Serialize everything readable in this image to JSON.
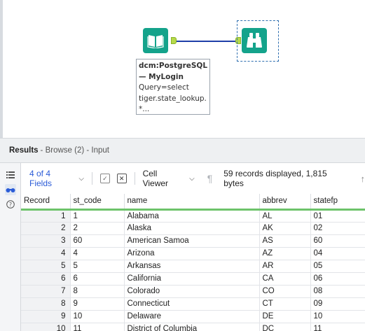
{
  "canvas": {
    "annotation": {
      "line1": "dcm:PostgreSQL",
      "line2": "— MyLogin",
      "line3": "Query=select",
      "line4": "tiger.state_lookup.",
      "line5": "*..."
    }
  },
  "results": {
    "title": "Results",
    "subtitle": "- Browse (2) - Input"
  },
  "toolbar": {
    "fields_label": "4 of 4 Fields",
    "viewer_label": "Cell Viewer",
    "records_info": "59 records displayed, 1,815 bytes"
  },
  "table": {
    "columns": [
      "Record",
      "st_code",
      "name",
      "abbrev",
      "statefp"
    ],
    "rows": [
      [
        "1",
        "1",
        "Alabama",
        "AL",
        "01"
      ],
      [
        "2",
        "2",
        "Alaska",
        "AK",
        "02"
      ],
      [
        "3",
        "60",
        "American Samoa",
        "AS",
        "60"
      ],
      [
        "4",
        "4",
        "Arizona",
        "AZ",
        "04"
      ],
      [
        "5",
        "5",
        "Arkansas",
        "AR",
        "05"
      ],
      [
        "6",
        "6",
        "California",
        "CA",
        "06"
      ],
      [
        "7",
        "8",
        "Colorado",
        "CO",
        "08"
      ],
      [
        "8",
        "9",
        "Connecticut",
        "CT",
        "09"
      ],
      [
        "9",
        "10",
        "Delaware",
        "DE",
        "10"
      ],
      [
        "10",
        "11",
        "District of Columbia",
        "DC",
        "11"
      ]
    ]
  },
  "colors": {
    "tool_accent": "#14a38b",
    "connector": "#1e3ea8",
    "link_blue": "#2a5bd7",
    "header_underline": "#6dc36a"
  }
}
